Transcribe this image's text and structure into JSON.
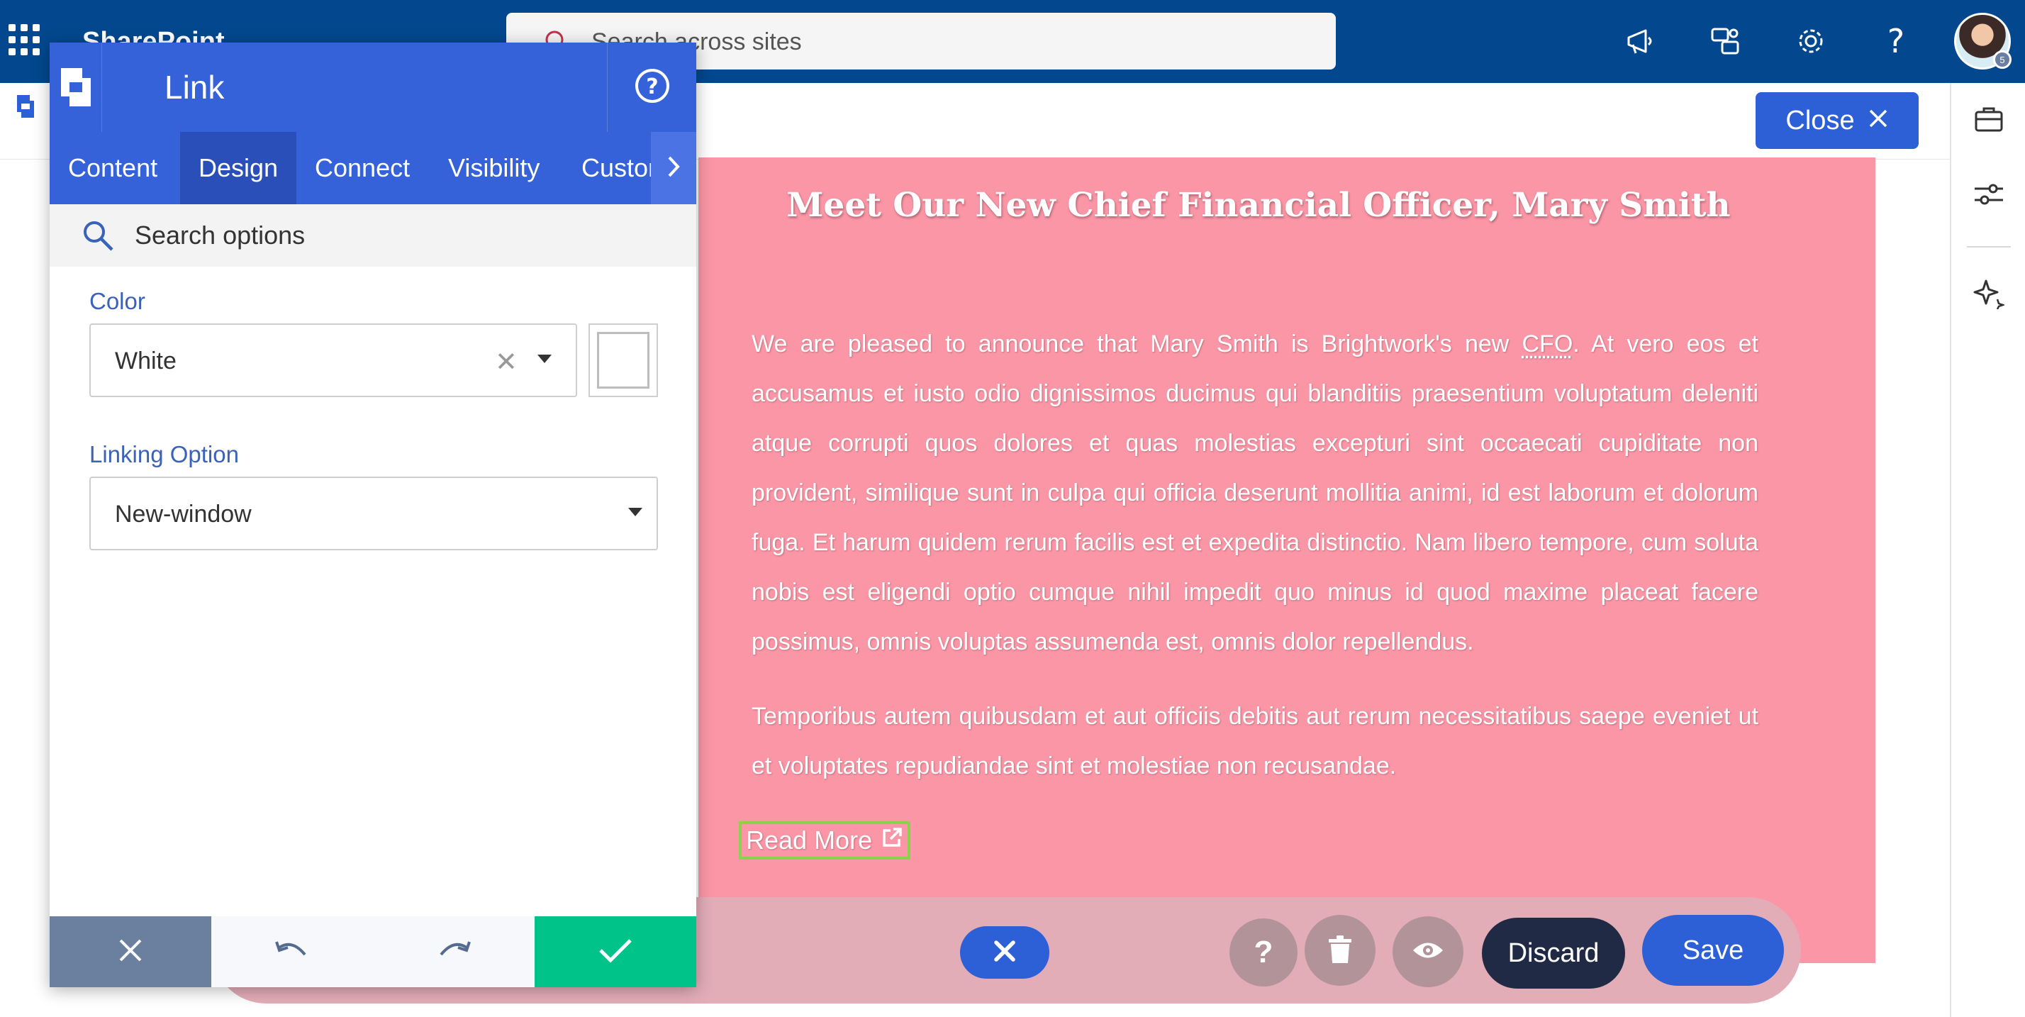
{
  "suite": {
    "app_name": "SharePoint",
    "search_placeholder": "Search across sites",
    "icons": [
      "waffle-icon",
      "megaphone-icon",
      "teams-chat-icon",
      "gear-icon",
      "help-icon"
    ],
    "avatar_presence": "5"
  },
  "command": {
    "close_label": "Close"
  },
  "panel": {
    "title": "Link",
    "tabs": [
      {
        "label": "Content"
      },
      {
        "label": "Design"
      },
      {
        "label": "Connect"
      },
      {
        "label": "Visibility"
      },
      {
        "label": "Custom"
      }
    ],
    "active_tab": "Design",
    "search_placeholder": "Search options",
    "color_label": "Color",
    "color_value": "White",
    "linking_label": "Linking Option",
    "linking_value": "New-window"
  },
  "card": {
    "title": "Meet Our New Chief Financial Officer, Mary Smith",
    "para1_before": "We are pleased to announce that Mary Smith is Brightwork's new ",
    "para1_abbr": "CFO",
    "para1_after": ". At vero eos et accusamus et iusto odio dignissimos ducimus qui blanditiis praesentium voluptatum deleniti atque corrupti quos dolores et quas molestias excepturi sint occaecati cupiditate non provident, similique sunt in culpa qui officia deserunt mollitia animi, id est laborum et dolorum fuga. Et harum quidem rerum facilis est et expedita distinctio. Nam libero tempore, cum soluta nobis est eligendi optio cumque nihil impedit quo minus id quod maxime placeat facere possimus, omnis voluptas assumenda est, omnis dolor repellendus.",
    "para2": "Temporibus autem quibusdam et aut officiis debitis aut rerum necessitatibus saepe eveniet ut et voluptates repudiandae sint et molestiae non recusandae.",
    "read_more": "Read More",
    "background_color": "#fb96a6"
  },
  "toolbar": {
    "discard_label": "Discard",
    "save_label": "Save"
  },
  "colors": {
    "suite_blue": "#03488e",
    "accent_blue": "#2d5fd7",
    "panel_blue": "#3561d9",
    "confirm_green": "#00c389",
    "cancel_slate": "#6b7f9e",
    "discard_navy": "#202a44"
  }
}
